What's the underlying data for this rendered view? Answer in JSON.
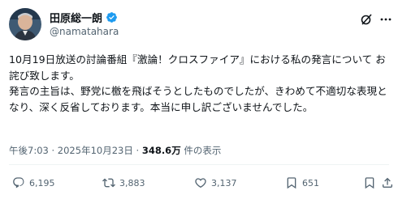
{
  "user": {
    "name": "田原総一朗",
    "handle": "@namatahara"
  },
  "post": {
    "text": "10月19日放送の討論番組『激論！クロスファイア』における私の発言について お詫び致します。\n発言の主旨は、野党に檄を飛ばそうとしたものでしたが、きわめて不適切な表現となり、深く反省しております。本当に申し訳ございませんでした。",
    "time": "午後7:03",
    "separator": "·",
    "date": "2025年10月23日",
    "views_count": "348.6万",
    "views_label": "件の表示"
  },
  "actions": {
    "replies": "6,195",
    "reposts": "3,883",
    "likes": "3,137",
    "views": "651"
  },
  "colors": {
    "text": "#0f1419",
    "secondary": "#536471",
    "verified": "#1d9bf0",
    "divider": "#eff3f4"
  },
  "icons": [
    "verified-badge-icon",
    "grok-icon",
    "more-icon",
    "reply-icon",
    "repost-icon",
    "like-icon",
    "views-icon",
    "bookmark-icon",
    "share-icon"
  ]
}
